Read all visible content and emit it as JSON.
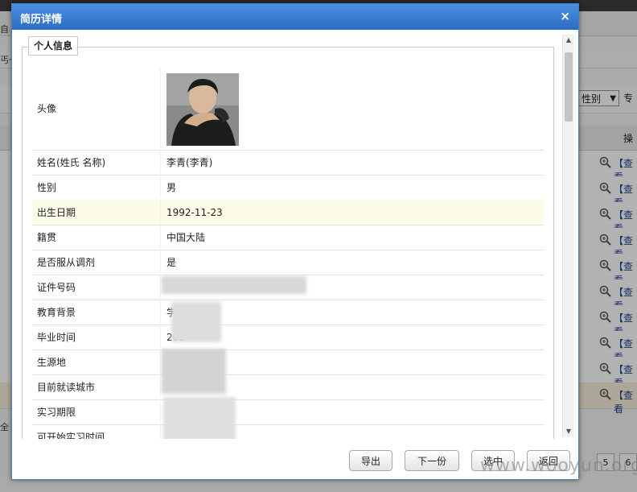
{
  "background": {
    "filter_select": "性别",
    "filter_after": "专",
    "op_header": "操",
    "row_action": "【查看",
    "left_labels": [
      "自",
      "丐一",
      "全"
    ],
    "pager": [
      "5",
      "6"
    ]
  },
  "modal": {
    "title": "简历详情",
    "close_symbol": "×",
    "section_legend": "个人信息",
    "fields": [
      {
        "label": "头像",
        "value": ""
      },
      {
        "label": "姓名(姓氏 名称)",
        "value": "李青(李青)"
      },
      {
        "label": "性别",
        "value": "男"
      },
      {
        "label": "出生日期",
        "value": "1992-11-23"
      },
      {
        "label": "籍贯",
        "value": "中国大陆"
      },
      {
        "label": "是否服从调剂",
        "value": "是"
      },
      {
        "label": "证件号码",
        "value": ""
      },
      {
        "label": "教育背景",
        "value": "学"
      },
      {
        "label": "毕业时间",
        "value": "201"
      },
      {
        "label": "生源地",
        "value": ""
      },
      {
        "label": "目前就读城市",
        "value": ""
      },
      {
        "label": "实习期限",
        "value": ""
      },
      {
        "label": "可开始实习时间",
        "value": ""
      }
    ],
    "buttons": {
      "export": "导出",
      "next": "下一份",
      "select": "选中",
      "back": "返回"
    }
  },
  "watermark": "www.wooyun.org"
}
